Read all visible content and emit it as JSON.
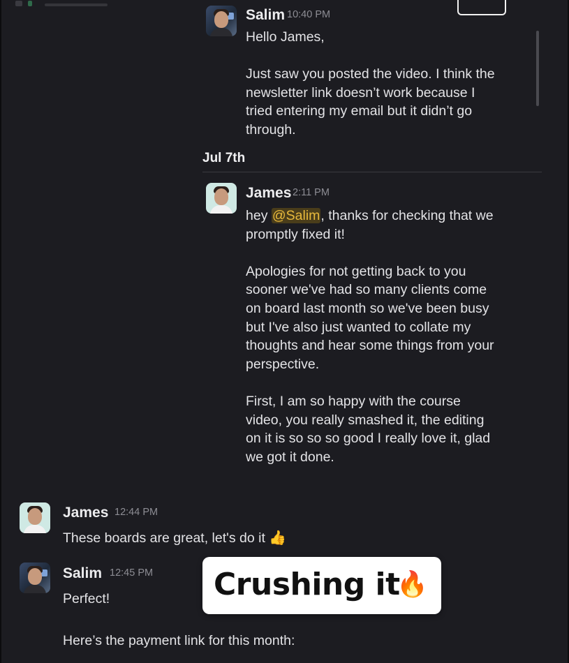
{
  "thread_message_1": {
    "sender": "Salim",
    "time": "10:40 PM",
    "lines": [
      "Hello James,",
      "",
      "Just saw you posted the video. I think the",
      "newsletter link doesn’t work because I",
      "tried entering my email but it didn’t go",
      "through."
    ]
  },
  "date_divider": "Jul 7th",
  "thread_message_2": {
    "sender": "James",
    "time": "2:11 PM",
    "greeting": "hey ",
    "mention": "@Salim",
    "line1_rest": ", thanks for checking that we",
    "line2": "promptly fixed it!",
    "para2": [
      "Apologies for not getting back to you",
      "sooner we've had so many clients come",
      "on board last month so we've been busy",
      "but I've also just wanted to collate my",
      "thoughts and hear some things from your",
      "perspective."
    ],
    "para3": [
      "First, I am so happy with the course",
      "video, you really smashed it, the editing",
      "on it is so so so good I really love it, glad",
      "we got it done."
    ]
  },
  "message_3": {
    "sender": "James",
    "time": "12:44 PM",
    "text": "These boards are great, let's do it",
    "emoji": "👍"
  },
  "message_4": {
    "sender": "Salim",
    "time": "12:45 PM",
    "line1": "Perfect!",
    "line2": "Here’s the payment link for this month:"
  },
  "sticker": {
    "text": "Crushing it",
    "emoji": "🔥"
  },
  "icons": {
    "thumbs_up": "thumbs-up-icon",
    "fire": "fire-icon"
  }
}
